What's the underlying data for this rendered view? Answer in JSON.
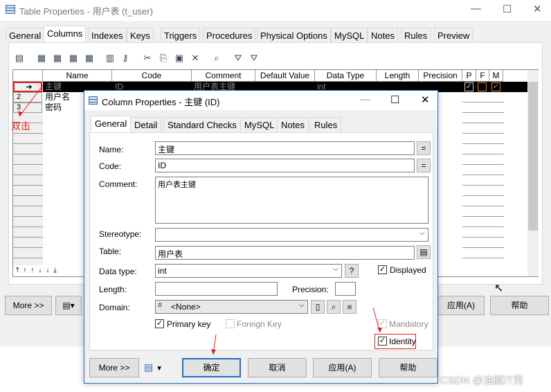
{
  "window": {
    "title": "Table Properties - 用户表 (t_user)",
    "minimize": "—",
    "maximize": "☐",
    "close": "✕"
  },
  "tabs": [
    "General",
    "Columns",
    "Indexes",
    "Keys",
    "Triggers",
    "Procedures",
    "Physical Options",
    "MySQL",
    "Notes",
    "Rules",
    "Preview"
  ],
  "active_tab": "Columns",
  "grid": {
    "headers": [
      "Name",
      "Code",
      "Comment",
      "Default Value",
      "Data Type",
      "Length",
      "Precision",
      "P",
      "F",
      "M"
    ],
    "rows": [
      {
        "marker": "➜",
        "name": "主键",
        "code": "ID",
        "comment": "用户表主键",
        "data_type": "int",
        "P": true,
        "F": false,
        "M": true
      },
      {
        "marker": "2",
        "name": "用户名",
        "code": "",
        "comment": "",
        "data_type": "",
        "P": false,
        "F": false,
        "M": false
      },
      {
        "marker": "3",
        "name": "密码",
        "code": "",
        "comment": "",
        "data_type": "",
        "P": false,
        "F": false,
        "M": false
      }
    ]
  },
  "annotation": "双击",
  "bottom": {
    "more": "More >>",
    "apply": "应用(A)",
    "help": "帮助"
  },
  "dialog": {
    "title": "Column Properties - 主键 (ID)",
    "tabs": [
      "General",
      "Detail",
      "Standard Checks",
      "MySQL",
      "Notes",
      "Rules"
    ],
    "active_tab": "General",
    "labels": {
      "name": "Name:",
      "code": "Code:",
      "comment": "Comment:",
      "stereotype": "Stereotype:",
      "table": "Table:",
      "data_type": "Data type:",
      "length": "Length:",
      "precision": "Precision:",
      "domain": "Domain:"
    },
    "values": {
      "name": "主键",
      "code": "ID",
      "comment": "用户表主键",
      "stereotype": "",
      "table": "用户表",
      "data_type": "int",
      "length": "",
      "precision": "",
      "domain": "<None>"
    },
    "eq": "=",
    "question": "?",
    "checks": {
      "displayed": {
        "label": "Displayed",
        "checked": true
      },
      "primary_key": {
        "label": "Primary key",
        "checked": true
      },
      "foreign_key": {
        "label": "Foreign Key",
        "checked": false
      },
      "mandatory": {
        "label": "Mandatory",
        "checked": true
      },
      "identity": {
        "label": "Identity",
        "checked": true
      }
    },
    "buttons": {
      "more": "More >>",
      "ok": "确定",
      "cancel": "取消",
      "apply": "应用(A)",
      "help": "帮助"
    }
  },
  "watermark": "CSDN @油腻IT男",
  "colors": {
    "accent": "#1e6fc9",
    "annotation": "#e02020",
    "selected_row": "#000000"
  }
}
